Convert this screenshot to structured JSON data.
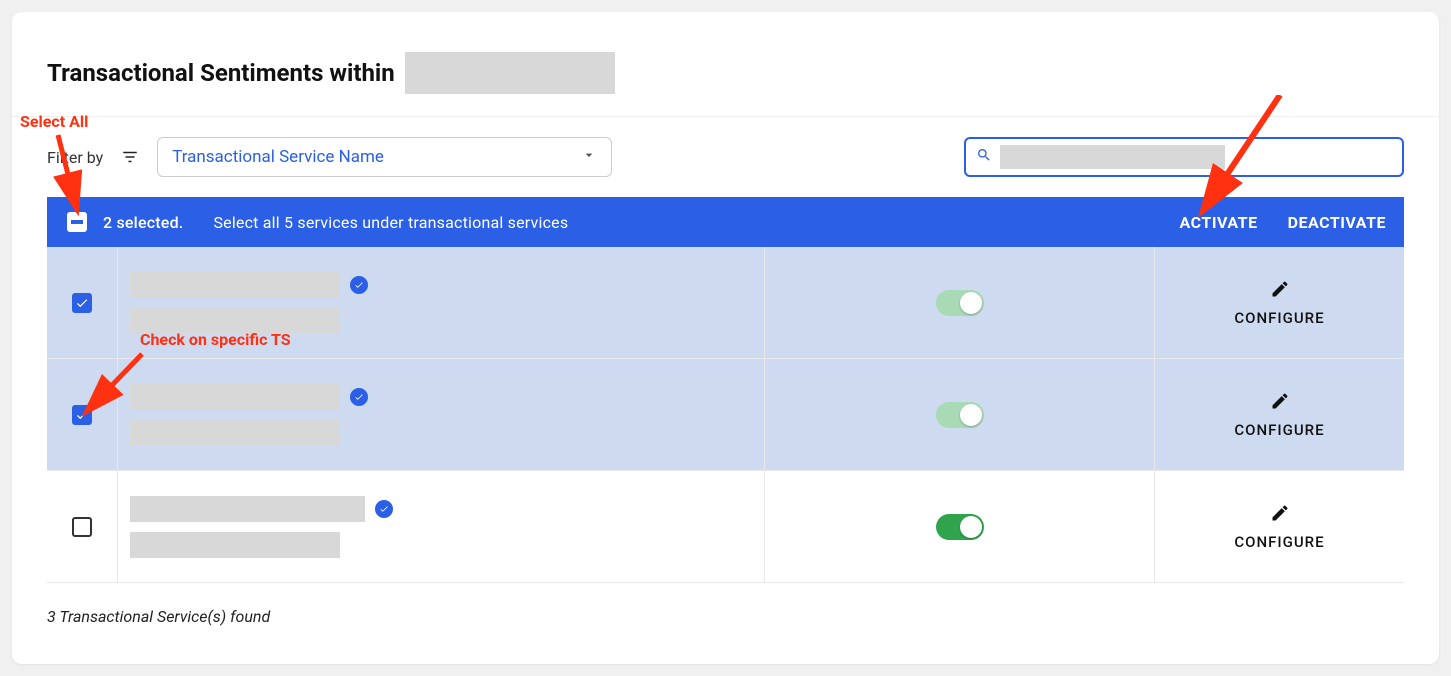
{
  "header": {
    "title_prefix": "Transactional Sentiments within"
  },
  "filter": {
    "label": "Filter by",
    "selected": "Transactional Service Name"
  },
  "banner": {
    "count_text": "2 selected.",
    "select_all_text": "Select all 5 services under transactional services",
    "activate": "ACTIVATE",
    "deactivate": "DEACTIVATE"
  },
  "rows": [
    {
      "checked": true,
      "toggle": "muted",
      "configure": "CONFIGURE"
    },
    {
      "checked": true,
      "toggle": "muted",
      "configure": "CONFIGURE"
    },
    {
      "checked": false,
      "toggle": "strong",
      "configure": "CONFIGURE"
    }
  ],
  "footer": {
    "count_text": "3 Transactional Service(s) found"
  },
  "annotations": {
    "select_all": "Select All",
    "check_specific": "Check on specific TS"
  }
}
